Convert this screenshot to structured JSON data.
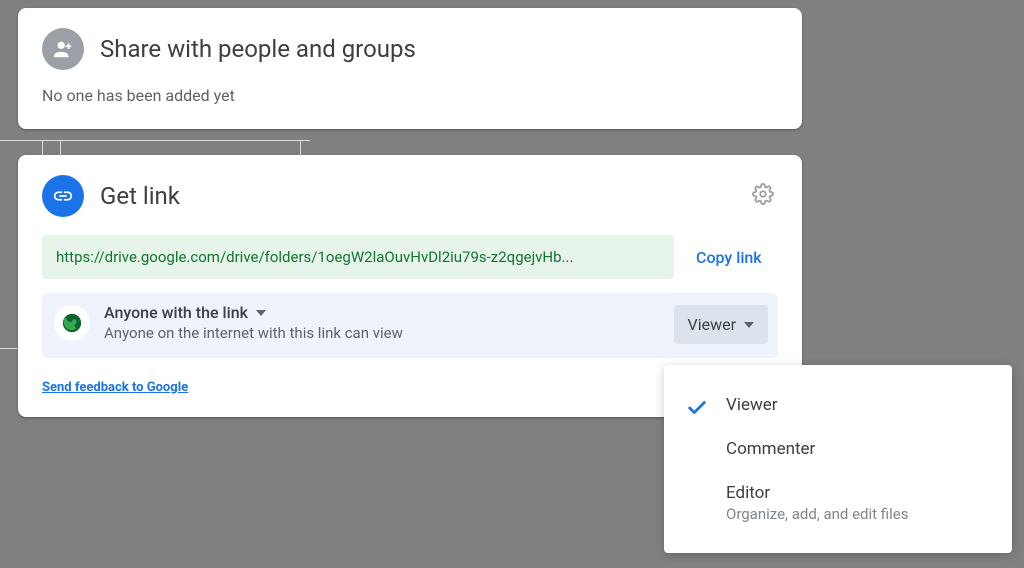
{
  "share": {
    "title": "Share with people and groups",
    "empty_text": "No one has been added yet"
  },
  "getlink": {
    "title": "Get link",
    "url": "https://drive.google.com/drive/folders/1oegW2laOuvHvDl2iu79s-z2qgejvHb...",
    "copy_label": "Copy link",
    "access": {
      "label": "Anyone with the link",
      "description": "Anyone on the internet with this link can view"
    },
    "role_selected": "Viewer",
    "feedback_label": "Send feedback to Google"
  },
  "role_menu": {
    "items": [
      {
        "label": "Viewer",
        "selected": true
      },
      {
        "label": "Commenter",
        "selected": false
      },
      {
        "label": "Editor",
        "sublabel": "Organize, add, and edit files",
        "selected": false
      }
    ]
  }
}
